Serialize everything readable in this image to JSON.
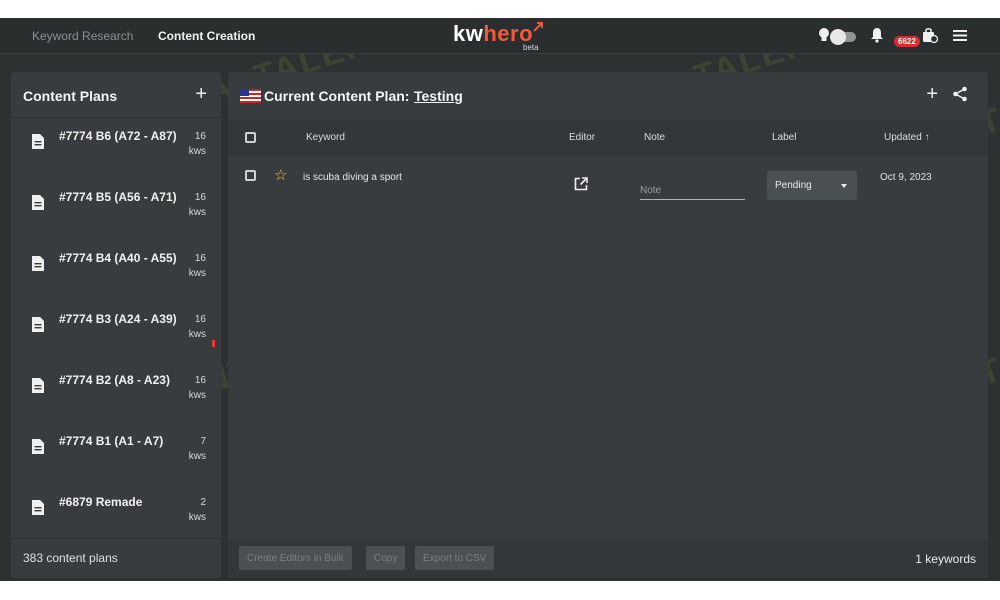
{
  "topbar": {
    "nav": [
      {
        "label": "Keyword Research"
      },
      {
        "label": "Content Creation"
      }
    ],
    "logo_kw": "kw",
    "logo_hero": "hero",
    "logo_beta": "beta",
    "credits_badge": "6622",
    "icons": [
      "lightbulb-icon",
      "theme-toggle",
      "bell-icon",
      "shopping-bag-icon",
      "menu-icon"
    ]
  },
  "sidebar": {
    "title": "Content Plans",
    "add_icon": "+",
    "plans": [
      {
        "name": "#7774 B6 (A72 - A87)",
        "count": "16",
        "unit": "kws"
      },
      {
        "name": "#7774 B5 (A56 - A71)",
        "count": "16",
        "unit": "kws"
      },
      {
        "name": "#7774 B4 (A40 - A55)",
        "count": "16",
        "unit": "kws"
      },
      {
        "name": "#7774 B3 (A24 - A39)",
        "count": "16",
        "unit": "kws"
      },
      {
        "name": "#7774 B2 (A8 - A23)",
        "count": "16",
        "unit": "kws"
      },
      {
        "name": "#7774 B1 (A1 - A7)",
        "count": "7",
        "unit": "kws"
      },
      {
        "name": "#6879 Remade",
        "count": "2",
        "unit": "kws"
      }
    ],
    "footer": "383 content plans"
  },
  "main": {
    "title_prefix": "Current Content Plan:",
    "title_name": "Testing",
    "add_icon": "+",
    "columns": {
      "keyword": "Keyword",
      "editor": "Editor",
      "note": "Note",
      "label": "Label",
      "updated": "Updated ↑"
    },
    "rows": [
      {
        "keyword": "is scuba diving a sport",
        "note_value": "",
        "note_placeholder": "Note",
        "label": "Pending",
        "updated": "Oct 9, 2023"
      }
    ],
    "footer": {
      "btn_bulk": "Create Editors in Bulk",
      "btn_copy": "Copy",
      "btn_export": "Export to CSV",
      "keyword_count": "1 keywords"
    }
  },
  "watermark": "AI TALENT SPACE",
  "colors": {
    "accent": "#f05a3a",
    "badge": "#d32f2f",
    "star": "#f2c230",
    "panel": "#383c3e",
    "background": "#2d3132"
  }
}
